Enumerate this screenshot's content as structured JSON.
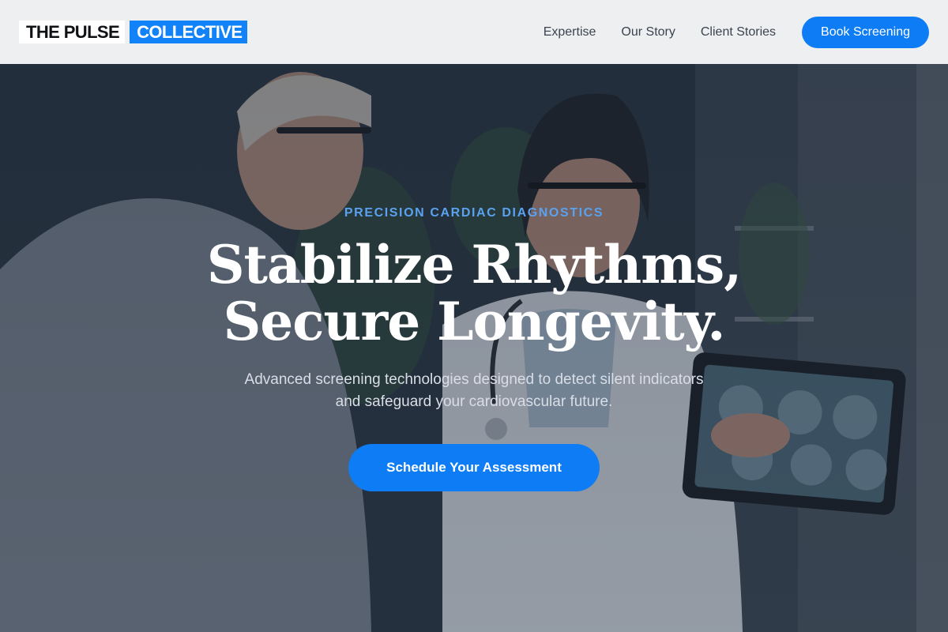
{
  "header": {
    "logo_part1": "THE PULSE",
    "logo_part2": "COLLECTIVE",
    "nav": [
      {
        "label": "Expertise"
      },
      {
        "label": "Our Story"
      },
      {
        "label": "Client Stories"
      }
    ],
    "cta_label": "Book Screening"
  },
  "hero": {
    "eyebrow": "PRECISION CARDIAC DIAGNOSTICS",
    "headline_line1": "Stabilize Rhythms,",
    "headline_line2": "Secure Longevity.",
    "subtitle_line1": "Advanced screening technologies designed to detect silent indicators",
    "subtitle_line2": "and safeguard your cardiovascular future.",
    "cta_label": "Schedule Your Assessment"
  },
  "colors": {
    "accent": "#0d7cf5",
    "eyebrow": "#5aa2ef",
    "header_bg": "#eeeff1"
  }
}
